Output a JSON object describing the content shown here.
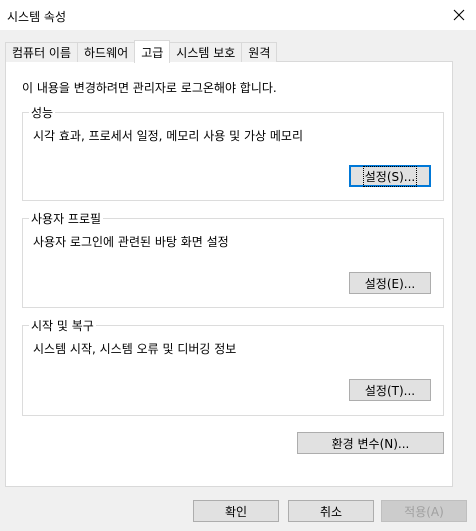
{
  "window": {
    "title": "시스템 속성"
  },
  "tabs": [
    {
      "label": "컴퓨터 이름"
    },
    {
      "label": "하드웨어"
    },
    {
      "label": "고급"
    },
    {
      "label": "시스템 보호"
    },
    {
      "label": "원격"
    }
  ],
  "notice": "이 내용을 변경하려면 관리자로 로그온해야 합니다.",
  "groups": {
    "performance": {
      "title": "성능",
      "desc": "시각 효과, 프로세서 일정, 메모리 사용 및 가상 메모리",
      "button": "설정(S)..."
    },
    "profile": {
      "title": "사용자 프로필",
      "desc": "사용자 로그인에 관련된 바탕 화면 설정",
      "button": "설정(E)..."
    },
    "startup": {
      "title": "시작 및 복구",
      "desc": "시스템 시작, 시스템 오류 및 디버깅 정보",
      "button": "설정(T)..."
    }
  },
  "env_button": "환경 변수(N)...",
  "footer": {
    "ok": "확인",
    "cancel": "취소",
    "apply": "적용(A)"
  },
  "icons": {
    "close": "close-icon"
  }
}
